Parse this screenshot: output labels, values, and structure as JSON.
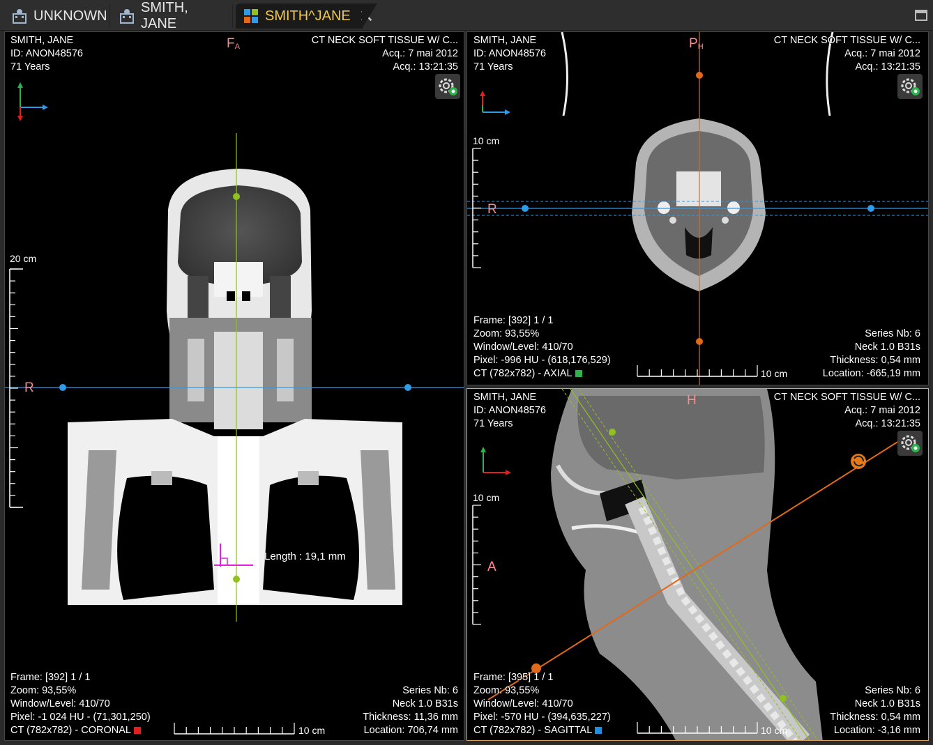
{
  "tabs": [
    {
      "label": "UNKNOWN",
      "icon": "patient-icon"
    },
    {
      "label": "SMITH, JANE",
      "icon": "patient-icon"
    },
    {
      "label": "SMITH^JANE",
      "icon": "mpr-icon",
      "close": "✕"
    }
  ],
  "colors": {
    "accent": "#f2c94c",
    "crosshair_blue": "#2e9be8",
    "crosshair_green": "#8fc21f",
    "crosshair_orange": "#e06a1a",
    "coronal_red": "#e02020",
    "axial_green": "#2db34a",
    "sagittal_blue": "#1e90e0",
    "measure_magenta": "#e020e0"
  },
  "coronal": {
    "patient_name": "SMITH, JANE",
    "patient_id": "ID: ANON48576",
    "age": "71 Years",
    "study": "CT NECK SOFT TISSUE  W/ C...",
    "acq_date": "Acq.: 7 mai 2012",
    "acq_time": "Acq.: 13:21:35",
    "orient_top": "F",
    "orient_top_sub": "A",
    "orient_left": "R",
    "scale_v": "20 cm",
    "scale_h": "10 cm",
    "frame": "Frame: [392] 1 / 1",
    "zoom": "Zoom: 93,55%",
    "wl": "Window/Level: 410/70",
    "pixel": "Pixel: -1 024 HU - (71,301,250)",
    "view": "CT (782x782) - CORONAL",
    "series": "Series Nb: 6",
    "desc": "Neck  1.0  B31s",
    "thickness": "Thickness: 11,36 mm",
    "location": "Location: 706,74 mm",
    "measure": "Length : 19,1 mm"
  },
  "axial": {
    "patient_name": "SMITH, JANE",
    "patient_id": "ID: ANON48576",
    "age": "71 Years",
    "study": "CT NECK SOFT TISSUE  W/ C...",
    "acq_date": "Acq.: 7 mai 2012",
    "acq_time": "Acq.: 13:21:35",
    "orient_top": "P",
    "orient_top_sub": "H",
    "orient_left": "R",
    "scale_v": "10 cm",
    "scale_h": "10 cm",
    "frame": "Frame: [392] 1 / 1",
    "zoom": "Zoom: 93,55%",
    "wl": "Window/Level: 410/70",
    "pixel": "Pixel: -996 HU - (618,176,529)",
    "view": "CT (782x782) - AXIAL",
    "series": "Series Nb: 6",
    "desc": "Neck  1.0  B31s",
    "thickness": "Thickness: 0,54 mm",
    "location": "Location: -665,19 mm"
  },
  "sagittal": {
    "patient_name": "SMITH, JANE",
    "patient_id": "ID: ANON48576",
    "age": "71 Years",
    "study": "CT NECK SOFT TISSUE  W/ C...",
    "acq_date": "Acq.: 7 mai 2012",
    "acq_time": "Acq.: 13:21:35",
    "orient_top": "H",
    "orient_left": "A",
    "scale_v": "10 cm",
    "scale_h": "10 cm",
    "frame": "Frame: [395] 1 / 1",
    "zoom": "Zoom: 93,55%",
    "wl": "Window/Level: 410/70",
    "pixel": "Pixel: -570 HU - (394,635,227)",
    "view": "CT (782x782) - SAGITTAL",
    "series": "Series Nb: 6",
    "desc": "Neck  1.0  B31s",
    "thickness": "Thickness: 0,54 mm",
    "location": "Location: -3,16 mm"
  }
}
